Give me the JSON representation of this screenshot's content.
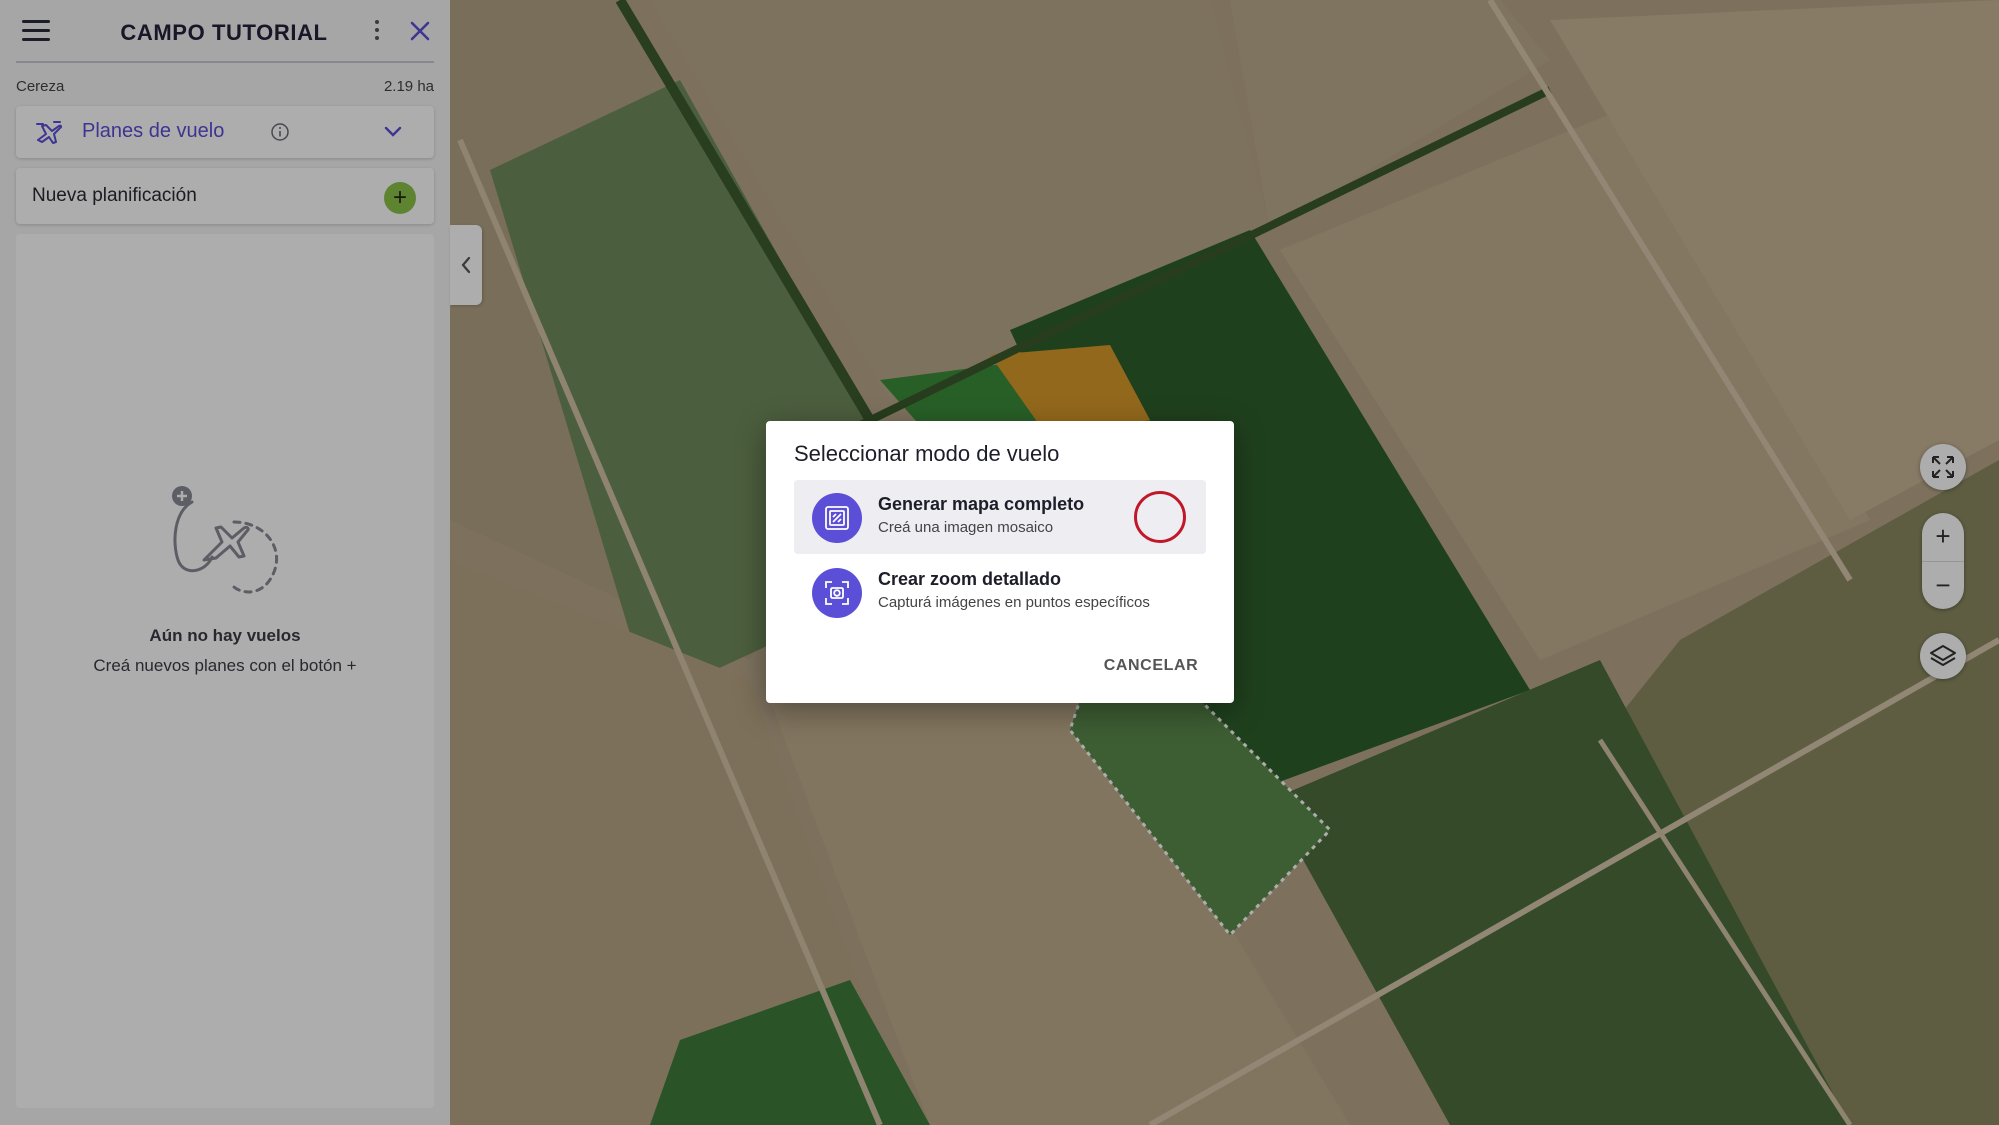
{
  "sidebar": {
    "title": "CAMPO TUTORIAL",
    "crop": "Cereza",
    "area": "2.19 ha",
    "section_label": "Planes de vuelo",
    "new_plan_label": "Nueva planificación",
    "add_symbol": "+",
    "empty_title": "Aún no hay vuelos",
    "empty_subtitle": "Creá nuevos planes con el botón +"
  },
  "map_controls": {
    "zoom_in": "+",
    "zoom_out": "−"
  },
  "dialog": {
    "title": "Seleccionar modo de vuelo",
    "options": [
      {
        "title": "Generar mapa completo",
        "subtitle": "Creá una imagen mosaico",
        "selected": true
      },
      {
        "title": "Crear zoom detallado",
        "subtitle": "Capturá imágenes en puntos específicos",
        "selected": false
      }
    ],
    "cancel_label": "CANCELAR"
  },
  "colors": {
    "accent": "#5b4fd8",
    "add_button": "#8bc34a",
    "selection_ring": "#c0182a"
  }
}
